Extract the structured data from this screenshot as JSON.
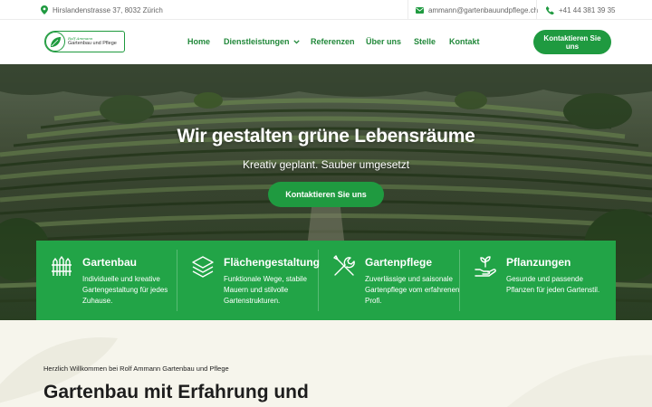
{
  "topbar": {
    "address": "Hirslandenstrasse 37, 8032 Zürich",
    "email": "ammann@gartenbauundpflege.ch",
    "phone": "+41 44 381 39 35",
    "icons": [
      "map-pin-icon",
      "envelope-icon",
      "phone-icon"
    ]
  },
  "logo": {
    "line1": "Rolf Ammann",
    "line2": "Gartenbau und Pflege"
  },
  "nav": {
    "items": [
      {
        "label": "Home"
      },
      {
        "label": "Dienstleistungen"
      },
      {
        "label": "Referenzen"
      },
      {
        "label": "Über uns"
      },
      {
        "label": "Stelle"
      },
      {
        "label": "Kontakt"
      }
    ],
    "cta": "Kontaktieren Sie uns"
  },
  "hero": {
    "title": "Wir gestalten grüne Lebensräume",
    "subtitle": "Kreativ geplant. Sauber umgesetzt",
    "button": "Kontaktieren Sie uns"
  },
  "services": [
    {
      "title": "Gartenbau",
      "text": "Individuelle und kreative Gartengestaltung für jedes Zuhause.",
      "icon": "garden-fence-icon"
    },
    {
      "title": "Flächengestaltung",
      "text": "Funktionale Wege, stabile Mauern und stilvolle Gartenstrukturen.",
      "icon": "layers-icon"
    },
    {
      "title": "Gartenpflege",
      "text": "Zuverlässige und saisonale Gartenpflege vom erfahrenen Profi.",
      "icon": "tools-icon"
    },
    {
      "title": "Pflanzungen",
      "text": "Gesunde und passende Pflanzen für jeden Gartenstil.",
      "icon": "plant-hand-icon"
    }
  ],
  "welcome": {
    "kicker": "Herzlich Willkommen bei Rolf Ammann Gartenbau und Pflege",
    "heading": "Gartenbau mit Erfahrung und"
  },
  "colors": {
    "brand_green": "#1f9a40",
    "nav_green": "#21883a",
    "panel_green": "#22a447",
    "cream": "#f6f5ec"
  }
}
